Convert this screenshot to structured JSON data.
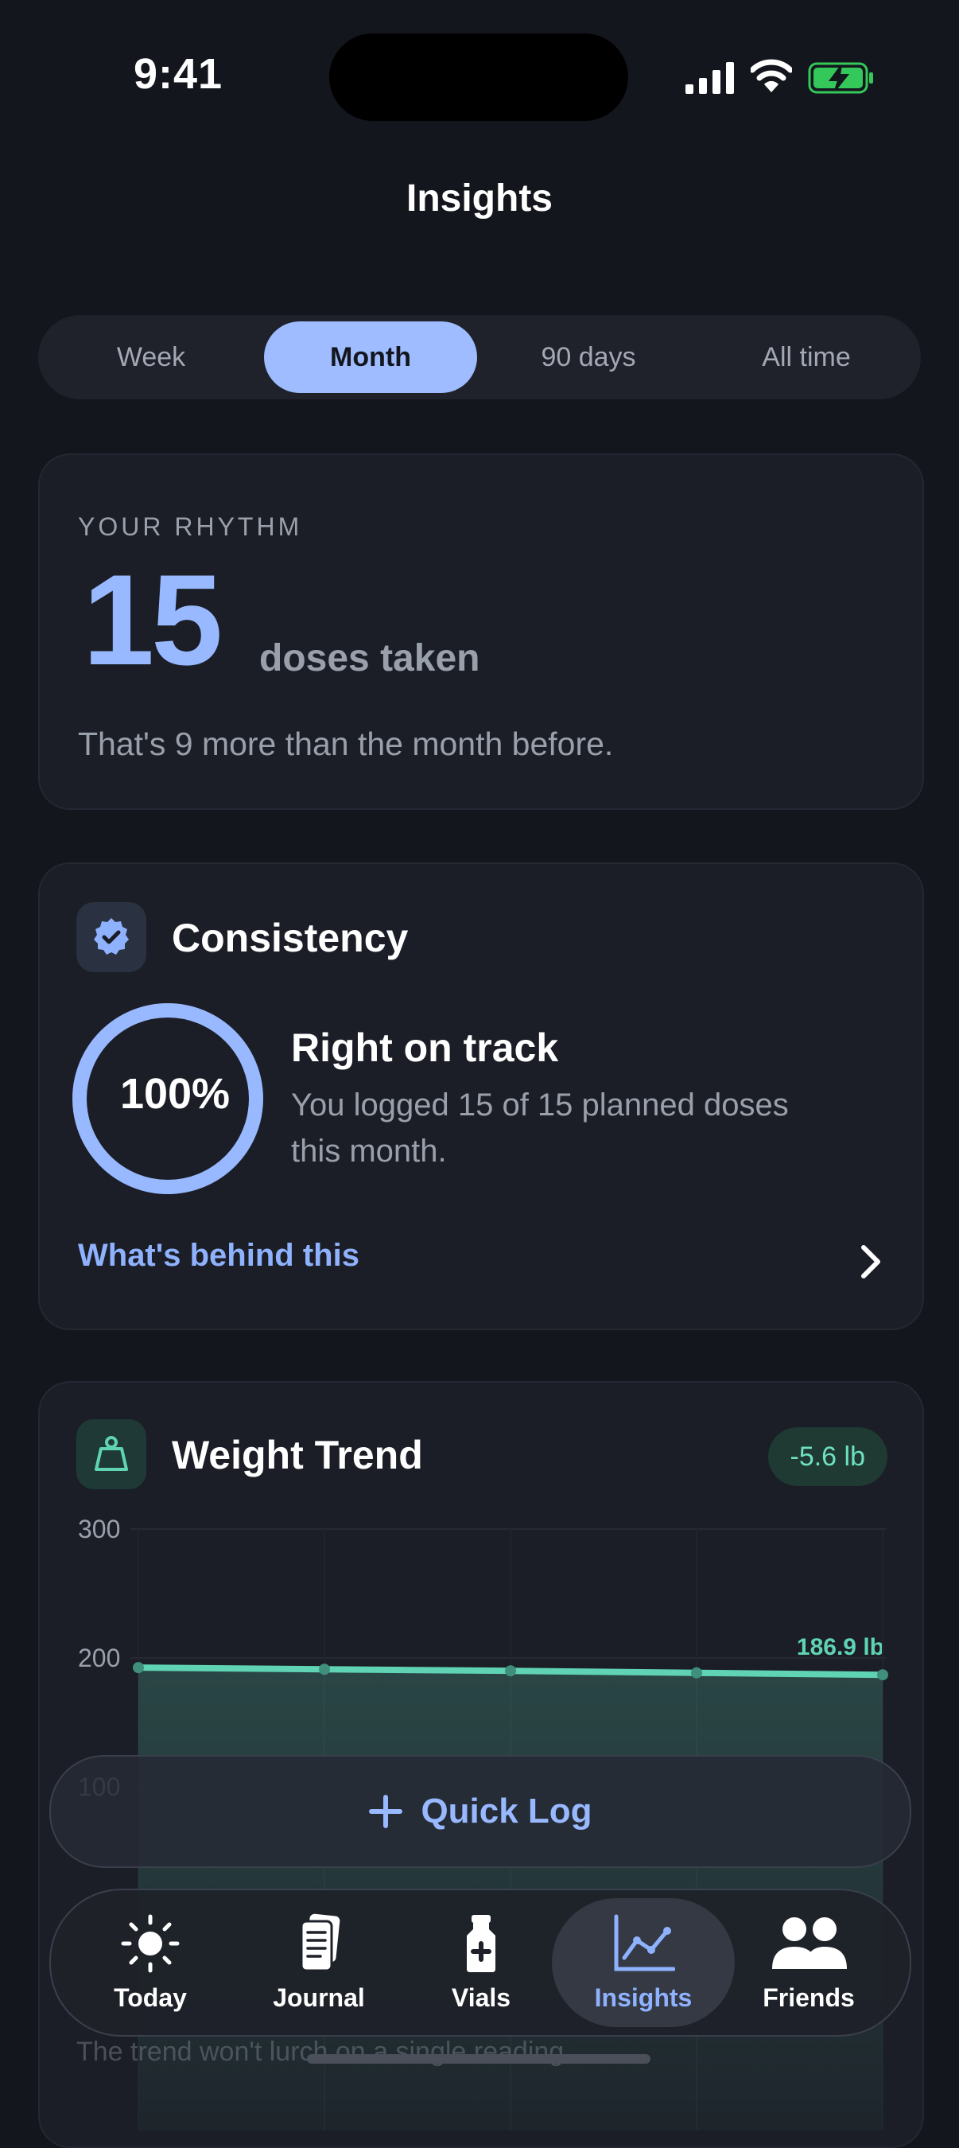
{
  "status_bar": {
    "time": "9:41"
  },
  "header": {
    "title": "Insights"
  },
  "range_tabs": [
    {
      "label": "Week"
    },
    {
      "label": "Month",
      "active": true
    },
    {
      "label": "90 days"
    },
    {
      "label": "All time"
    }
  ],
  "rhythm": {
    "label": "YOUR RHYTHM",
    "value": "15",
    "unit": "doses taken",
    "subtitle": "That's 9 more than the month before."
  },
  "consistency": {
    "title": "Consistency",
    "percent": "100%",
    "percent_value": 100,
    "status": "Right on track",
    "description": "You logged 15 of 15 planned doses this month.",
    "link": "What's behind this",
    "icon": "verified-badge-icon"
  },
  "weight_trend": {
    "title": "Weight Trend",
    "badge": "-5.6 lb",
    "last_value_label": "186.9 lb",
    "icon": "scale-icon"
  },
  "chart_data": {
    "type": "area",
    "y_ticks": [
      "300",
      "200",
      "100"
    ],
    "ylim": [
      100,
      300
    ],
    "series": [
      {
        "values": [
          192.5,
          191.2,
          190.0,
          188.4,
          186.9
        ]
      }
    ],
    "colors": {
      "line": "#5fd3b4"
    }
  },
  "quick_log": {
    "label": "Quick Log"
  },
  "tab_bar": [
    {
      "label": "Today",
      "icon": "sun-icon"
    },
    {
      "label": "Journal",
      "icon": "journal-icon"
    },
    {
      "label": "Vials",
      "icon": "vial-icon"
    },
    {
      "label": "Insights",
      "icon": "chart-icon",
      "active": true
    },
    {
      "label": "Friends",
      "icon": "friends-icon"
    }
  ],
  "footer_hint": "The trend won't lurch on a single reading.",
  "colors": {
    "accent": "#98b8ff",
    "background": "#14161d",
    "card": "#1b1e26",
    "teal": "#5fd3b4"
  }
}
